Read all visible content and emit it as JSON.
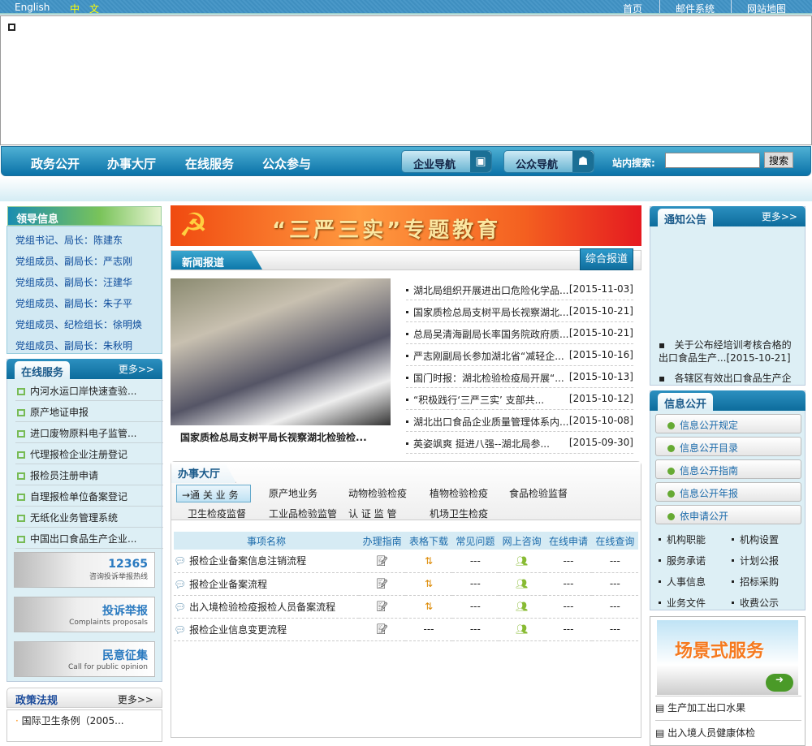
{
  "topbar": {
    "english": "English",
    "chinese": "中　文",
    "links": [
      "首页",
      "邮件系统",
      "网站地图"
    ]
  },
  "nav": {
    "menu": [
      "政务公开",
      "办事大厅",
      "在线服务",
      "公众参与"
    ],
    "enterprise_nav": "企业导航",
    "public_nav": "公众导航",
    "search_label": "站内搜索:",
    "search_value": "",
    "search_button": "搜索"
  },
  "leaders": {
    "title": "领导信息",
    "items": [
      "党组书记、局长：陈建东",
      "党组成员、副局长：严志刚",
      "党组成员、副局长：汪建华",
      "党组成员、副局长：朱子平",
      "党组成员、纪检组长：徐明焕",
      "党组成员、副局长：朱秋明"
    ]
  },
  "online": {
    "title": "在线服务",
    "more": "更多>>",
    "items": [
      "内河水运口岸快速查验...",
      "原产地证申报",
      "进口废物原料电子监管...",
      "代理报检企业注册登记",
      "报检员注册申请",
      "自理报检单位备案登记",
      "无纸化业务管理系统",
      "中国出口食品生产企业..."
    ]
  },
  "banners": [
    {
      "title": "12365",
      "sub": "咨询投诉举报热线"
    },
    {
      "title": "投诉举报",
      "sub": "Complaints proposals"
    },
    {
      "title": "民意征集",
      "sub": "Call for public opinion"
    }
  ],
  "policy": {
    "title": "政策法规",
    "more": "更多>>",
    "items": [
      "国际卫生条例（2005..."
    ]
  },
  "center": {
    "banner": "“三严三实”专题教育",
    "news_title": "新闻报道",
    "news_tab": "综合报道",
    "photo_caption": "国家质检总局支树平局长视察湖北检验检...",
    "news": [
      {
        "t": "湖北局组织开展进出口危险化学品...",
        "d": "[2015-11-03]"
      },
      {
        "t": "国家质检总局支树平局长视察湖北...",
        "d": "[2015-10-21]"
      },
      {
        "t": "总局吴清海副局长率国务院政府质...",
        "d": "[2015-10-21]"
      },
      {
        "t": "严志刚副局长参加湖北省“减轻企...",
        "d": "[2015-10-16]"
      },
      {
        "t": "国门时报：湖北检验检疫局开展“...",
        "d": "[2015-10-13]"
      },
      {
        "t": "“积极践行‘三严三实’ 支部共...",
        "d": "[2015-10-12]"
      },
      {
        "t": "湖北出口食品企业质量管理体系内...",
        "d": "[2015-10-08]"
      },
      {
        "t": "英姿飒爽 挺进八强--湖北局参...",
        "d": "[2015-09-30]"
      }
    ]
  },
  "hall": {
    "title": "办事大厅",
    "tabs": [
      "→通 关 业 务",
      "原产地业务",
      "动物检验检疫",
      "植物检验检疫",
      "食品检验监督",
      "卫生检疫监督",
      "工业品检验监管",
      "认 证 监 管",
      "机场卫生检疫"
    ],
    "columns": [
      "事项名称",
      "办理指南",
      "表格下载",
      "常见问题",
      "网上咨询",
      "在线申请",
      "在线查询"
    ],
    "rows": [
      {
        "name": "报检企业备案信息注销流程",
        "download": true,
        "faq": "---",
        "apply": "---",
        "query": "---"
      },
      {
        "name": "报检企业备案流程",
        "download": true,
        "faq": "---",
        "apply": "---",
        "query": "---"
      },
      {
        "name": "出入境检验检疫报检人员备案流程",
        "download": true,
        "faq": "---",
        "apply": "---",
        "query": "---"
      },
      {
        "name": "报检企业信息变更流程",
        "download": false,
        "dl_text": "---",
        "faq": "---",
        "apply": "---",
        "query": "---"
      }
    ]
  },
  "notice": {
    "title": "通知公告",
    "more": "更多>>",
    "items": [
      "关于公布经培训考核合格的出口食品生产...[2015-10-21]",
      "各辖区有效出口食品生产企"
    ]
  },
  "info": {
    "title": "信息公开",
    "buttons": [
      "信息公开规定",
      "信息公开目录",
      "信息公开指南",
      "信息公开年报",
      "依申请公开"
    ],
    "links": [
      "机构职能",
      "机构设置",
      "服务承诺",
      "计划公报",
      "人事信息",
      "招标采购",
      "业务文件",
      "收费公示"
    ]
  },
  "scene": {
    "title": "场景式服务",
    "items": [
      "生产加工出口水果",
      "出入境人员健康体检"
    ]
  }
}
